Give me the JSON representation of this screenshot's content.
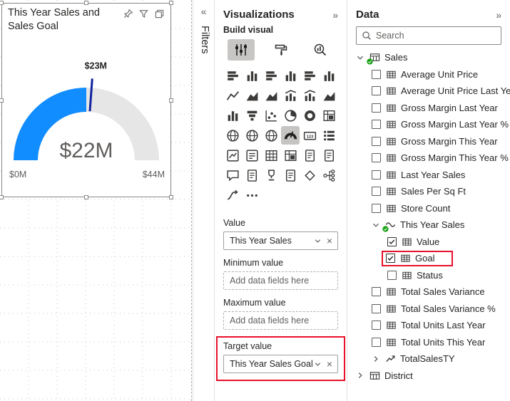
{
  "glyphs": {
    "collapse_left": "«",
    "collapse_right": "»",
    "remove": "×"
  },
  "highlight_color": "#E8112D",
  "canvas": {
    "visual": {
      "title": "This Year Sales and Sales Goal",
      "header_icons": [
        {
          "name": "pin-icon"
        },
        {
          "name": "filter-icon"
        },
        {
          "name": "copy-icon"
        }
      ],
      "gauge": {
        "value_label": "$22M",
        "min_label": "$0M",
        "max_label": "$44M",
        "target_label": "$23M",
        "fill_fraction": 0.5,
        "target_fraction": 0.523,
        "fill_color": "#118DFF",
        "track_color": "#E6E6E6",
        "needle_color": "#12239E",
        "value_color": "#605E5C",
        "label_color": "#605E5C",
        "target_text_color": "#252423"
      }
    }
  },
  "filters_pane": {
    "title": "Filters"
  },
  "visualizations_pane": {
    "title": "Visualizations",
    "section_title": "Build visual",
    "tabs": [
      {
        "name": "build-visual-tab",
        "icon": "build",
        "selected": true
      },
      {
        "name": "format-visual-tab",
        "icon": "format",
        "selected": false
      },
      {
        "name": "analytics-tab",
        "icon": "analytics",
        "selected": false
      }
    ],
    "visual_icons": [
      {
        "name": "stacked-bar-chart-icon",
        "a": "hbars"
      },
      {
        "name": "stacked-column-chart-icon",
        "a": "vbars"
      },
      {
        "name": "clustered-bar-chart-icon",
        "a": "hbars"
      },
      {
        "name": "clustered-column-chart-icon",
        "a": "vbars"
      },
      {
        "name": "hundred-percent-stacked-bar-chart-icon",
        "a": "hbars"
      },
      {
        "name": "hundred-percent-stacked-column-chart-icon",
        "a": "vbars"
      },
      {
        "name": "line-chart-icon",
        "a": "line"
      },
      {
        "name": "area-chart-icon",
        "a": "area"
      },
      {
        "name": "stacked-area-chart-icon",
        "a": "area"
      },
      {
        "name": "line-and-stacked-column-chart-icon",
        "a": "combo"
      },
      {
        "name": "line-and-clustered-column-chart-icon",
        "a": "combo"
      },
      {
        "name": "ribbon-chart-icon",
        "a": "area"
      },
      {
        "name": "waterfall-chart-icon",
        "a": "vbars"
      },
      {
        "name": "funnel-chart-icon",
        "a": "funnel"
      },
      {
        "name": "scatter-chart-icon",
        "a": "scatter"
      },
      {
        "name": "pie-chart-icon",
        "a": "pie"
      },
      {
        "name": "donut-chart-icon",
        "a": "donut"
      },
      {
        "name": "treemap-icon",
        "a": "matrix"
      },
      {
        "name": "map-icon",
        "a": "map"
      },
      {
        "name": "filled-map-icon",
        "a": "map"
      },
      {
        "name": "azure-map-icon",
        "a": "map"
      },
      {
        "name": "gauge-icon",
        "a": "gauge",
        "selected": true
      },
      {
        "name": "card-icon",
        "a": "card"
      },
      {
        "name": "multi-row-card-icon",
        "a": "list"
      },
      {
        "name": "kpi-icon",
        "a": "kpi"
      },
      {
        "name": "slicer-icon",
        "a": "slicer"
      },
      {
        "name": "table-visual-icon",
        "a": "table"
      },
      {
        "name": "matrix-visual-icon",
        "a": "matrix"
      },
      {
        "name": "r-script-visual-icon",
        "a": "doc"
      },
      {
        "name": "python-visual-icon",
        "a": "doc"
      },
      {
        "name": "q-and-a-icon",
        "a": "bubble"
      },
      {
        "name": "smart-narrative-icon",
        "a": "doc"
      },
      {
        "name": "metrics-icon",
        "a": "trophy"
      },
      {
        "name": "paginated-report-icon",
        "a": "doc"
      },
      {
        "name": "power-apps-icon",
        "a": "diamond"
      },
      {
        "name": "decomposition-tree-icon",
        "a": "tree"
      },
      {
        "name": "key-influencers-icon",
        "a": "flow"
      },
      {
        "name": "more-visuals-icon",
        "a": "dots"
      }
    ],
    "wells": [
      {
        "label": "Value",
        "value": "This Year Sales"
      },
      {
        "label": "Minimum value",
        "placeholder": "Add data fields here"
      },
      {
        "label": "Maximum value",
        "placeholder": "Add data fields here"
      },
      {
        "label": "Target value",
        "value": "This Year Sales Goal",
        "highlighted": true
      }
    ]
  },
  "data_pane": {
    "title": "Data",
    "search_placeholder": "Search",
    "tree": [
      {
        "label": "Sales",
        "level": 0,
        "chevron": "down",
        "icon": "table",
        "badge": true
      },
      {
        "label": "Average Unit Price",
        "level": 1,
        "checkbox": false,
        "icon": "grid"
      },
      {
        "label": "Average Unit Price Last Year",
        "level": 1,
        "checkbox": false,
        "icon": "grid"
      },
      {
        "label": "Gross Margin Last Year",
        "level": 1,
        "checkbox": false,
        "icon": "grid"
      },
      {
        "label": "Gross Margin Last Year %",
        "level": 1,
        "checkbox": false,
        "icon": "grid"
      },
      {
        "label": "Gross Margin This Year",
        "level": 1,
        "checkbox": false,
        "icon": "grid"
      },
      {
        "label": "Gross Margin This Year %",
        "level": 1,
        "checkbox": false,
        "icon": "grid"
      },
      {
        "label": "Last Year Sales",
        "level": 1,
        "checkbox": false,
        "icon": "grid"
      },
      {
        "label": "Sales Per Sq Ft",
        "level": 1,
        "checkbox": false,
        "icon": "grid"
      },
      {
        "label": "Store Count",
        "level": 1,
        "checkbox": false,
        "icon": "grid"
      },
      {
        "label": "This Year Sales",
        "level": 1,
        "chevron": "down",
        "icon": "wave",
        "badge": true
      },
      {
        "label": "Value",
        "level": 2,
        "checkbox": true,
        "icon": "grid"
      },
      {
        "label": "Goal",
        "level": 2,
        "checkbox": true,
        "icon": "grid",
        "highlighted": true
      },
      {
        "label": "Status",
        "level": 2,
        "checkbox": false,
        "icon": "grid"
      },
      {
        "label": "Total Sales Variance",
        "level": 1,
        "checkbox": false,
        "icon": "grid"
      },
      {
        "label": "Total Sales Variance %",
        "level": 1,
        "checkbox": false,
        "icon": "grid"
      },
      {
        "label": "Total Units Last Year",
        "level": 1,
        "checkbox": false,
        "icon": "grid"
      },
      {
        "label": "Total Units This Year",
        "level": 1,
        "checkbox": false,
        "icon": "grid"
      },
      {
        "label": "TotalSalesTY",
        "level": 1,
        "chevron": "right",
        "icon": "zigzag"
      },
      {
        "label": "District",
        "level": 0,
        "chevron": "right",
        "icon": "table"
      }
    ]
  }
}
